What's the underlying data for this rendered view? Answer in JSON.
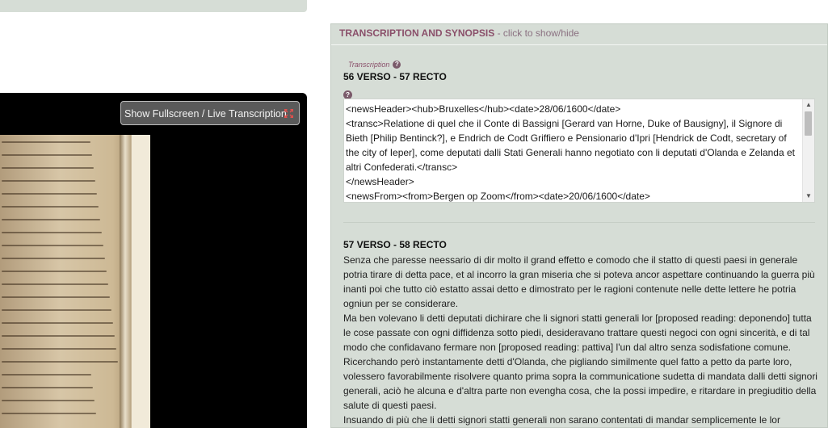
{
  "viewer": {
    "fullscreen_label": "Show Fullscreen / Live Transcription"
  },
  "panel": {
    "title": "TRANSCRIPTION AND SYNOPSIS",
    "hint": " - click to show/hide",
    "section_label": "Transcription",
    "heading1": "56 VERSO - 57 RECTO",
    "code_lines": [
      "<newsHeader><hub>Bruxelles</hub><date>28/06/1600</date>",
      "<transc>Relatione di quel che il Conte di Bassigni [Gerard van Horne, Duke of Bausigny], il Signore di",
      "Bieth [Philip Bentinck?], e Endrich de Codt Griffiero e Pensionario d'Ipri [Hendrick de Codt, secretary of",
      "the city of Ieper], come deputati dalli Stati Generali hanno negotiato con li deputati d'Olanda e Zelanda et",
      "altri Confederati.</transc>",
      "</newsHeader>",
      "<newsFrom><from>Bergen op Zoom</from><date>20/06/1600</date>"
    ],
    "heading2": "57 VERSO - 58 RECTO",
    "paragraphs": [
      "Senza che paresse neessario di dir molto il grand effetto e comodo che il statto di questi paesi in generale potria tirare di detta pace, et al incorro la gran miseria che si poteva ancor aspettare continuando la guerra più inanti poi che tutto ciò estatto assai detto e dimostrato per le ragioni contenute nelle dette lettere he potria ogniun per se considerare.",
      "Ma ben volevano li detti deputati dichirare che li signori statti generali lor [proposed reading: deponendo] tutta le cose passate con ogni diffidenza sotto piedi, desideravano trattare questi negoci con ogni sincerità, e di tal modo che confidavano fermare non [proposed reading: pattiva] l'un dal altro senza sodisfatione comune.",
      "Ricerchando però instantamente detti d'Olanda, che pigliando similmente quel fatto a petto da parte loro, volessero favorabilmente risolvere quanto prima sopra la communicatione sudetta di mandata dalli detti signori generali, aciò he alcuna e d'altra parte non evengha cosa, che la possi impedire, e ritardare in pregiuditio della salute di questi paesi.",
      "Insuando di più che li detti signori statti generali non sarano contentati di mandar semplicemente le lor"
    ]
  }
}
